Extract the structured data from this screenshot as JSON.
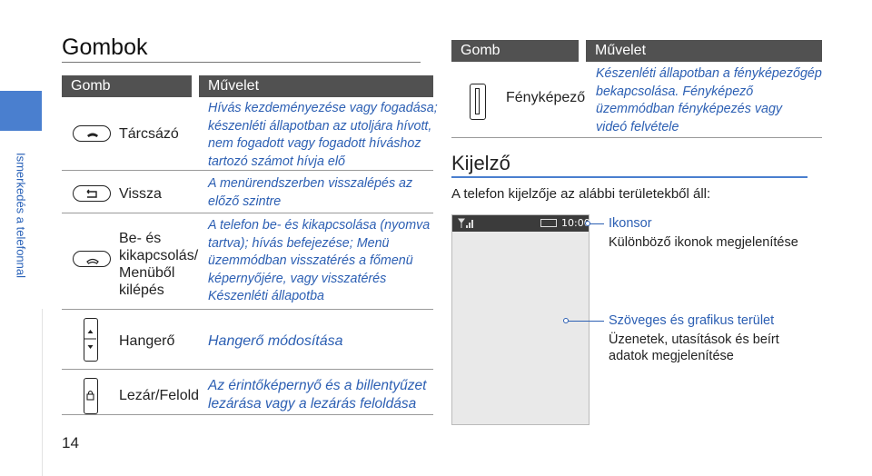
{
  "sidebar": {
    "label": "Ismerkedés a telefonnal",
    "accent": "#4a7fcf"
  },
  "page_number": "14",
  "title": "Gombok",
  "left_table": {
    "col_key": "Gomb",
    "col_action": "Művelet",
    "rows": [
      {
        "name": [
          "Tárcsázó"
        ],
        "icon": "call-key-icon",
        "text": [
          "Hívás kezdeményezése vagy fogadása;",
          "készenléti állapotban az utoljára hívott,",
          "nem fogadott vagy fogadott híváshoz",
          "tartozó számot hívja elő"
        ]
      },
      {
        "name": [
          "Vissza"
        ],
        "icon": "back-key-icon",
        "text": [
          "A menürendszerben visszalépés az",
          "előző szintre"
        ]
      },
      {
        "name": [
          "Be- és",
          "kikapcsolás/",
          "Menüből",
          "kilépés"
        ],
        "icon": "power-key-icon",
        "text": [
          "A telefon be- és kikapcsolása (nyomva",
          "tartva); hívás befejezése; Menü",
          "üzemmódban visszatérés a főmenü",
          "képernyőjére, vagy visszatérés",
          "Készenléti állapotba"
        ]
      },
      {
        "name": [
          "Hangerő"
        ],
        "icon": "volume-key-icon",
        "text": [
          "Hangerő módosítása"
        ]
      },
      {
        "name": [
          "Lezár/Felold"
        ],
        "icon": "lock-key-icon",
        "text": [
          "Az érintőképernyő és a billentyűzet",
          "lezárása vagy a lezárás feloldása"
        ]
      }
    ]
  },
  "right_table": {
    "col_key": "Gomb",
    "col_action": "Művelet",
    "rows": [
      {
        "name": [
          "Fényképező"
        ],
        "icon": "camera-key-icon",
        "text": [
          "Készenléti állapotban a fényképezőgép",
          "bekapcsolása. Fényképező",
          "üzemmódban fényképezés vagy",
          "videó felvétele"
        ]
      }
    ]
  },
  "display": {
    "title": "Kijelző",
    "intro": "A telefon kijelzője az alábbi területekből áll:",
    "status_time": "10:00",
    "callouts": [
      {
        "head": "Ikonsor",
        "body": [
          "Különböző ikonok megjelenítése"
        ]
      },
      {
        "head": "Szöveges és grafikus terület",
        "body": [
          "Üzenetek, utasítások és beírt",
          "adatok megjelenítése"
        ]
      }
    ]
  },
  "colors": {
    "accent": "#4a7fcf",
    "header": "#515151",
    "blue_text": "#2c5fb3"
  }
}
